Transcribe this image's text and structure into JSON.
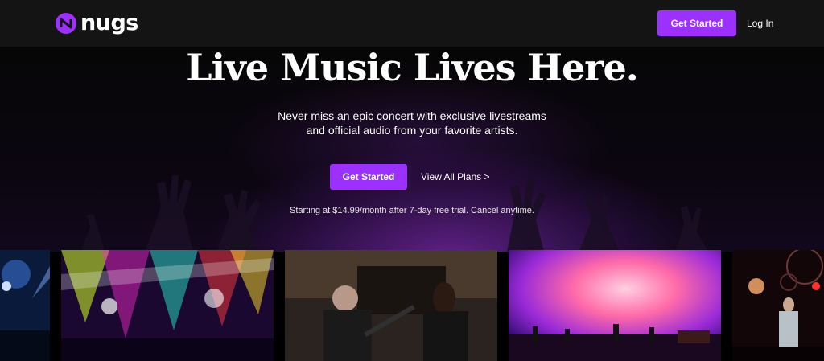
{
  "header": {
    "logo_text": "nugs",
    "get_started_label": "Get Started",
    "login_label": "Log In"
  },
  "hero": {
    "headline": "Live Music Lives Here.",
    "subtitle_line1": "Never miss an epic concert with exclusive livestreams",
    "subtitle_line2": "and official audio from your favorite artists.",
    "get_started_label": "Get Started",
    "view_plans_label": "View All Plans >",
    "pricing_note": "Starting at $14.99/month after 7-day free trial. Cancel anytime."
  },
  "colors": {
    "accent": "#9b30ff",
    "nav_background": "#141414",
    "page_background": "#000000"
  },
  "icons": {
    "logo": "nugs-logo-icon"
  }
}
